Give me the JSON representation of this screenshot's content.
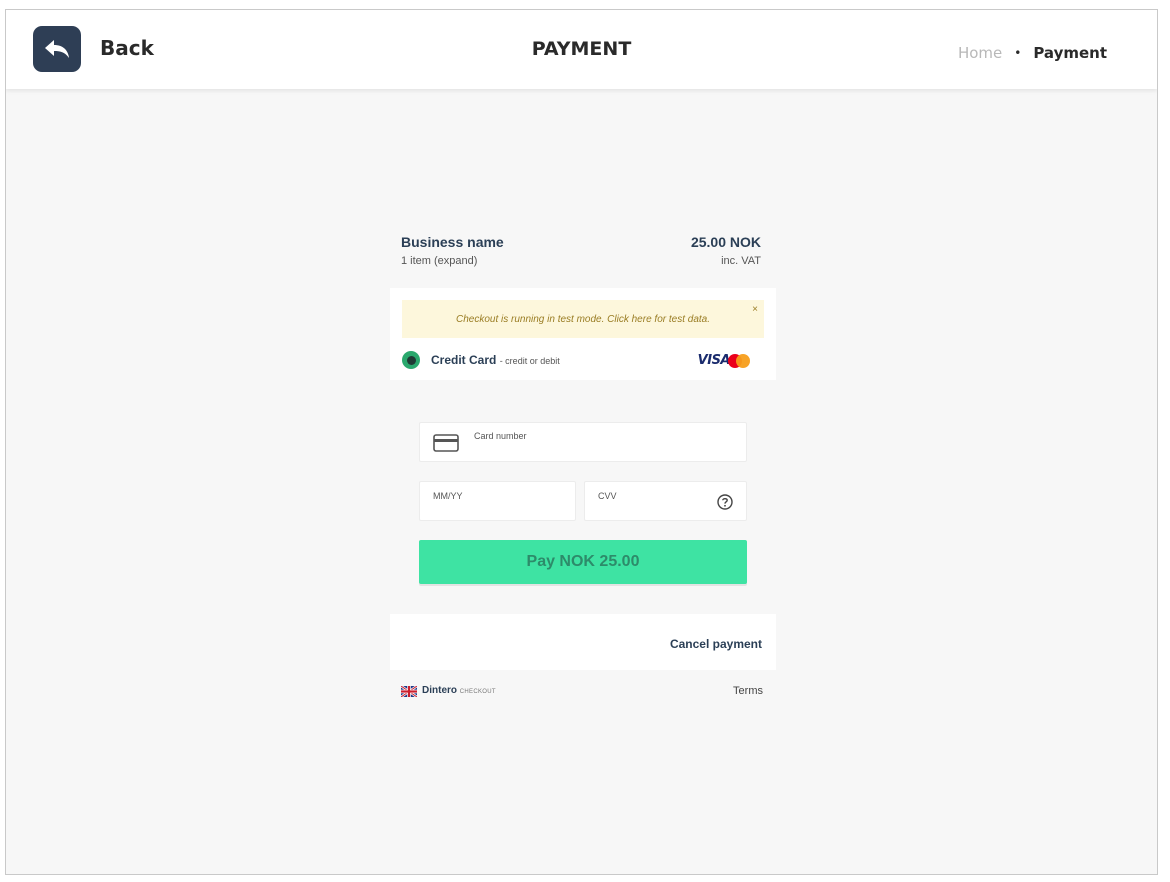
{
  "header": {
    "back_label": "Back",
    "title": "PAYMENT",
    "breadcrumb": {
      "home": "Home",
      "separator": "•",
      "current": "Payment"
    }
  },
  "summary": {
    "business_name": "Business name",
    "item_count": "1 item (expand)",
    "amount": "25.00 NOK",
    "vat_note": "inc. VAT"
  },
  "test_banner": {
    "text": "Checkout is running in test mode. Click here for test data.",
    "close": "×"
  },
  "payment_method": {
    "label": "Credit Card",
    "sublabel": "- credit or debit",
    "brands": [
      "VISA",
      "mastercard-icon"
    ],
    "selected": true
  },
  "form": {
    "card_number_label": "Card number",
    "expiry_label": "MM/YY",
    "cvv_label": "CVV",
    "pay_button": "Pay NOK 25.00"
  },
  "cancel_label": "Cancel payment",
  "footer": {
    "brand": "Dintero",
    "brand_tag": "CHECKOUT",
    "terms": "Terms"
  },
  "colors": {
    "accent": "#3ee3a3",
    "header_button": "#2e3e55",
    "banner_bg": "#fdf7dc",
    "radio": "#2aa86d"
  }
}
